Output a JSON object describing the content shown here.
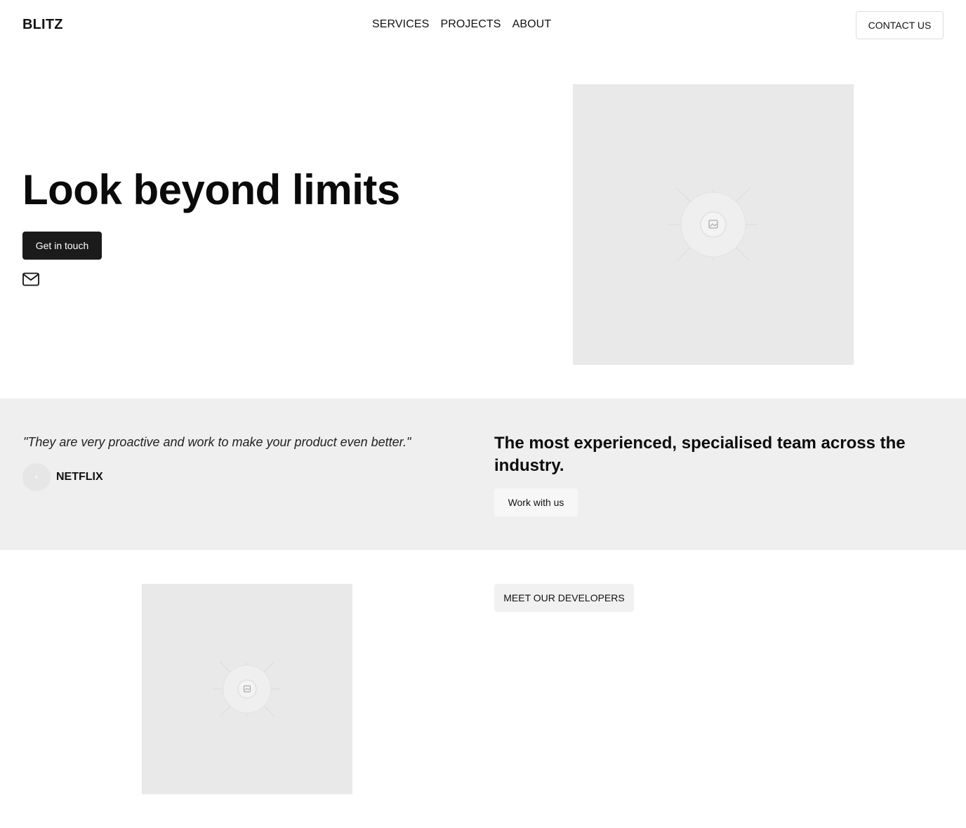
{
  "header": {
    "logo": "BLITZ",
    "nav": [
      "SERVICES",
      "PROJECTS",
      "ABOUT"
    ],
    "contact_label": "CONTACT US"
  },
  "hero": {
    "title": "Look beyond limits",
    "cta_label": "Get in touch",
    "mail_icon": "mail-icon",
    "image_icon": "image-placeholder-icon"
  },
  "testimonial": {
    "quote": "\"They are very proactive and work to make your product even better.\"",
    "company": "NETFLIX"
  },
  "team": {
    "heading": "The most experienced, specialised team across the industry.",
    "cta_label": "Work with us"
  },
  "developers": {
    "cta_label": "MEET OUR DEVELOPERS",
    "image_icon": "image-placeholder-icon"
  },
  "colors": {
    "primary_button": "#1b1b1b",
    "band_background": "#efefef",
    "placeholder": "#e9e9e9"
  }
}
